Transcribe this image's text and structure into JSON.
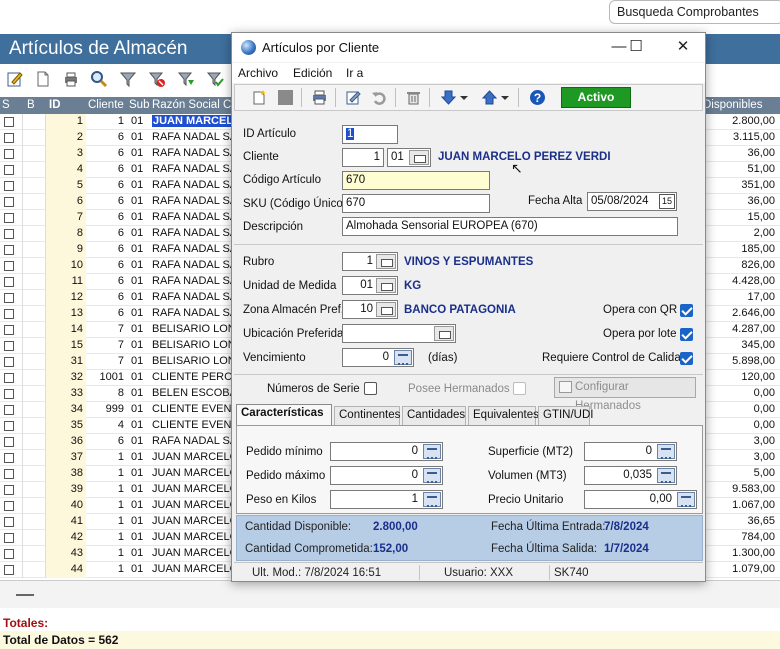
{
  "search_pill": "Busqueda Comprobantes",
  "main_title": "Artículos de Almacén",
  "grid": {
    "headers": {
      "s": "S",
      "b": "B",
      "id": "ID",
      "cliente": "Cliente",
      "sub": "Sub",
      "razon": "Razón Social Clie",
      "disponibles": "Disponibles"
    },
    "rows": [
      {
        "id": "1",
        "cliente": "1",
        "sub": "01",
        "razon": "JUAN MARCELO",
        "disp": "2.800,00",
        "sel": true
      },
      {
        "id": "2",
        "cliente": "6",
        "sub": "01",
        "razon": "RAFA NADAL SA",
        "disp": "3.115,00"
      },
      {
        "id": "3",
        "cliente": "6",
        "sub": "01",
        "razon": "RAFA NADAL SA",
        "disp": "36,00"
      },
      {
        "id": "4",
        "cliente": "6",
        "sub": "01",
        "razon": "RAFA NADAL SA",
        "disp": "51,00"
      },
      {
        "id": "5",
        "cliente": "6",
        "sub": "01",
        "razon": "RAFA NADAL SA",
        "disp": "351,00"
      },
      {
        "id": "6",
        "cliente": "6",
        "sub": "01",
        "razon": "RAFA NADAL SA",
        "disp": "36,00"
      },
      {
        "id": "7",
        "cliente": "6",
        "sub": "01",
        "razon": "RAFA NADAL SA",
        "disp": "15,00"
      },
      {
        "id": "8",
        "cliente": "6",
        "sub": "01",
        "razon": "RAFA NADAL SA",
        "disp": "2,00"
      },
      {
        "id": "9",
        "cliente": "6",
        "sub": "01",
        "razon": "RAFA NADAL SA",
        "disp": "185,00"
      },
      {
        "id": "10",
        "cliente": "6",
        "sub": "01",
        "razon": "RAFA NADAL SA",
        "disp": "826,00"
      },
      {
        "id": "11",
        "cliente": "6",
        "sub": "01",
        "razon": "RAFA NADAL SA",
        "disp": "4.428,00"
      },
      {
        "id": "12",
        "cliente": "6",
        "sub": "01",
        "razon": "RAFA NADAL SA",
        "disp": "17,00"
      },
      {
        "id": "13",
        "cliente": "6",
        "sub": "01",
        "razon": "RAFA NADAL SA",
        "disp": "2.646,00"
      },
      {
        "id": "14",
        "cliente": "7",
        "sub": "01",
        "razon": "BELISARIO LONC",
        "disp": "4.287,00"
      },
      {
        "id": "15",
        "cliente": "7",
        "sub": "01",
        "razon": "BELISARIO LONC",
        "disp": "345,00"
      },
      {
        "id": "31",
        "cliente": "7",
        "sub": "01",
        "razon": "BELISARIO LONC",
        "disp": "5.898,00"
      },
      {
        "id": "32",
        "cliente": "1001",
        "sub": "01",
        "razon": "CLIENTE PERCEF",
        "disp": "120,00"
      },
      {
        "id": "33",
        "cliente": "8",
        "sub": "01",
        "razon": "BELEN ESCOBAR",
        "disp": "0,00"
      },
      {
        "id": "34",
        "cliente": "999",
        "sub": "01",
        "razon": "CLIENTE EVENTU",
        "disp": "0,00"
      },
      {
        "id": "35",
        "cliente": "4",
        "sub": "01",
        "razon": "CLIENTE EVENTU",
        "disp": "0,00"
      },
      {
        "id": "36",
        "cliente": "6",
        "sub": "01",
        "razon": "RAFA NADAL SA",
        "disp": "3,00"
      },
      {
        "id": "37",
        "cliente": "1",
        "sub": "01",
        "razon": "JUAN MARCELO",
        "disp": "3,00"
      },
      {
        "id": "38",
        "cliente": "1",
        "sub": "01",
        "razon": "JUAN MARCELO",
        "disp": "5,00"
      },
      {
        "id": "39",
        "cliente": "1",
        "sub": "01",
        "razon": "JUAN MARCELO",
        "disp": "9.583,00"
      },
      {
        "id": "40",
        "cliente": "1",
        "sub": "01",
        "razon": "JUAN MARCELO",
        "disp": "1.067,00"
      },
      {
        "id": "41",
        "cliente": "1",
        "sub": "01",
        "razon": "JUAN MARCELO",
        "disp": "36,65"
      },
      {
        "id": "42",
        "cliente": "1",
        "sub": "01",
        "razon": "JUAN MARCELO",
        "disp": "784,00"
      },
      {
        "id": "43",
        "cliente": "1",
        "sub": "01",
        "razon": "JUAN MARCELO",
        "disp": "1.300,00"
      },
      {
        "id": "44",
        "cliente": "1",
        "sub": "01",
        "razon": "JUAN MARCELO",
        "disp": "1.079,00"
      }
    ]
  },
  "totals": {
    "label": "Totales:",
    "count": "Total de Datos = 562"
  },
  "dialog": {
    "title": "Artículos por Cliente",
    "menu": {
      "archivo": "Archivo",
      "edicion": "Edición",
      "ira": "Ir a"
    },
    "status_button": "Activo",
    "fields": {
      "id_articulo": {
        "label": "ID Artículo",
        "value": "1"
      },
      "cliente": {
        "label": "Cliente",
        "value": "1",
        "sub": "01",
        "name": "JUAN MARCELO PEREZ VERDI"
      },
      "codigo_articulo": {
        "label": "Código Artículo",
        "value": "670"
      },
      "sku": {
        "label": "SKU (Código Único)",
        "value": "670"
      },
      "fecha_alta": {
        "label": "Fecha Alta",
        "value": "05/08/2024"
      },
      "descripcion": {
        "label": "Descripción",
        "value": "Almohada Sensorial EUROPEA (670)"
      },
      "rubro": {
        "label": "Rubro",
        "value": "1",
        "name": "VINOS Y ESPUMANTES"
      },
      "unidad": {
        "label": "Unidad de Medida",
        "value": "01",
        "name": "KG"
      },
      "zona": {
        "label": "Zona Almacén Pref.",
        "value": "10",
        "name": "BANCO PATAGONIA"
      },
      "ubicacion": {
        "label": "Ubicación Preferida",
        "value": ""
      },
      "vencimiento": {
        "label": "Vencimiento",
        "value": "0",
        "unit": "(días)"
      }
    },
    "checks": {
      "opera_qr": {
        "label": "Opera con QR",
        "checked": true
      },
      "opera_lote": {
        "label": "Opera por lote",
        "checked": true
      },
      "control_calidad": {
        "label": "Requiere Control de Calidad",
        "checked": true
      },
      "numeros_serie": {
        "label": "Números de Serie",
        "checked": false
      },
      "posee_hermanados": {
        "label": "Posee Hermanados",
        "checked": false
      }
    },
    "configurar_button": "Configurar Hermanados",
    "tabs": [
      "Características",
      "Continentes",
      "Cantidades",
      "Equivalentes",
      "GTIN/UDI"
    ],
    "caracteristicas": {
      "pedido_minimo": {
        "label": "Pedido mínimo",
        "value": "0"
      },
      "pedido_maximo": {
        "label": "Pedido máximo",
        "value": "0"
      },
      "peso": {
        "label": "Peso en Kilos",
        "value": "1"
      },
      "superficie": {
        "label": "Superficie (MT2)",
        "value": "0"
      },
      "volumen": {
        "label": "Volumen (MT3)",
        "value": "0,035"
      },
      "precio": {
        "label": "Precio Unitario",
        "value": "0,00"
      }
    },
    "summary": {
      "cant_disp_label": "Cantidad Disponible:",
      "cant_disp": "2.800,00",
      "cant_comp_label": "Cantidad Comprometida:",
      "cant_comp": "152,00",
      "f_entrada_label": "Fecha Última Entrada:",
      "f_entrada": "7/8/2024",
      "f_salida_label": "Fecha Última Salida:",
      "f_salida": "1/7/2024"
    },
    "status": {
      "ult_mod": "Ult. Mod.: 7/8/2024 16:51",
      "usuario": "Usuario: XXX",
      "code": "SK740"
    }
  },
  "colors": {
    "title_bar": "#3f6f9c",
    "grid_header": "#6a7f94",
    "activo": "#1e9a24",
    "selected_row": "#1f4fd0",
    "summary": "#b7cde6"
  }
}
